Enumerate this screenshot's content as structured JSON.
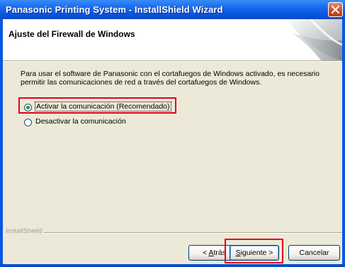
{
  "window": {
    "title": "Panasonic Printing System - InstallShield Wizard",
    "title_bar_color": "#0a54db",
    "close_button_color": "#d14a22"
  },
  "header": {
    "title": "Ajuste del Firewall de Windows"
  },
  "body": {
    "description": "Para usar el software de Panasonic con el cortafuegos de Windows activado, es necesario permitir las comunicaciones de red a través del cortafuegos de Windows.",
    "options": [
      {
        "label": "Activar la comunicación (Recomendado)",
        "selected": true
      },
      {
        "label": "Desactivar la comunicación",
        "selected": false
      }
    ]
  },
  "footer": {
    "brand": "InstallShield",
    "back_prefix": "< ",
    "back_key": "A",
    "back_rest": "trás",
    "next_key": "S",
    "next_rest": "iguiente >",
    "cancel_label": "Cancelar"
  },
  "highlight_color": "#e3001b"
}
